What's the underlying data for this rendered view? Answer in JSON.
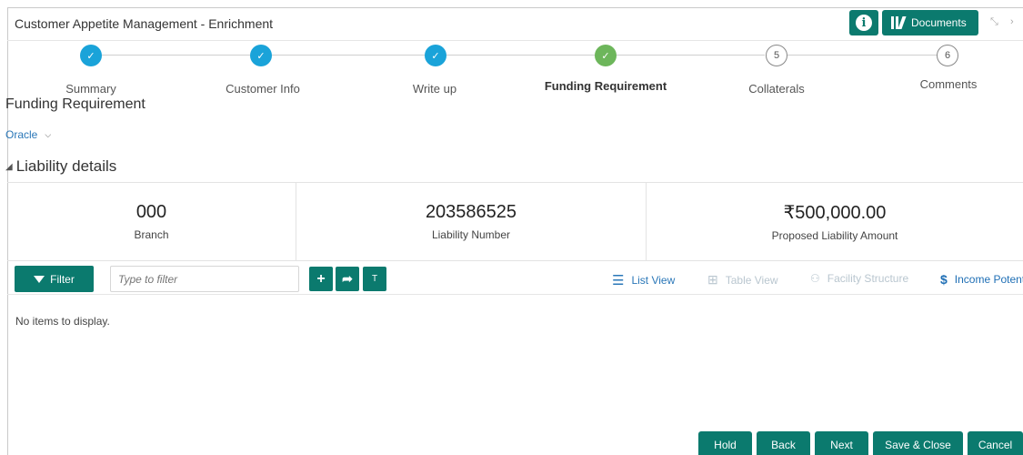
{
  "header": {
    "title": "Customer Appetite Management - Enrichment",
    "documents_label": "Documents",
    "info_icon": "info-icon"
  },
  "stepper": {
    "steps": [
      {
        "label": "Summary",
        "state": "done"
      },
      {
        "label": "Customer Info",
        "state": "done"
      },
      {
        "label": "Write up",
        "state": "done"
      },
      {
        "label": "Funding Requirement",
        "state": "current"
      },
      {
        "label": "Collaterals",
        "state": "todo",
        "number": "5"
      },
      {
        "label": "Comments",
        "state": "todo",
        "number": "6"
      }
    ]
  },
  "page": {
    "heading": "Funding Requirement",
    "entity": "Oracle",
    "section": "Liability details"
  },
  "summary": {
    "branch_value": "000",
    "branch_label": "Branch",
    "liability_number_value": "203586525",
    "liability_number_label": "Liability Number",
    "amount_value": "₹500,000.00",
    "amount_label": "Proposed Liability Amount"
  },
  "toolbar": {
    "filter_label": "Filter",
    "filter_placeholder": "Type to filter",
    "add_icon": "plus-icon",
    "share_icon": "forward-arrow-icon",
    "t_label": "T",
    "list_view": "List View",
    "table_view": "Table View",
    "facility_structure": "Facility Structure",
    "income_potential": "Income Potent"
  },
  "content": {
    "empty_message": "No items to display."
  },
  "footer": {
    "hold": "Hold",
    "back": "Back",
    "next": "Next",
    "save_close": "Save & Close",
    "cancel": "Cancel"
  },
  "colors": {
    "primary": "#0b7a6e",
    "step_done": "#1aa3d9",
    "step_current": "#6db65b",
    "link": "#2a77b8"
  }
}
